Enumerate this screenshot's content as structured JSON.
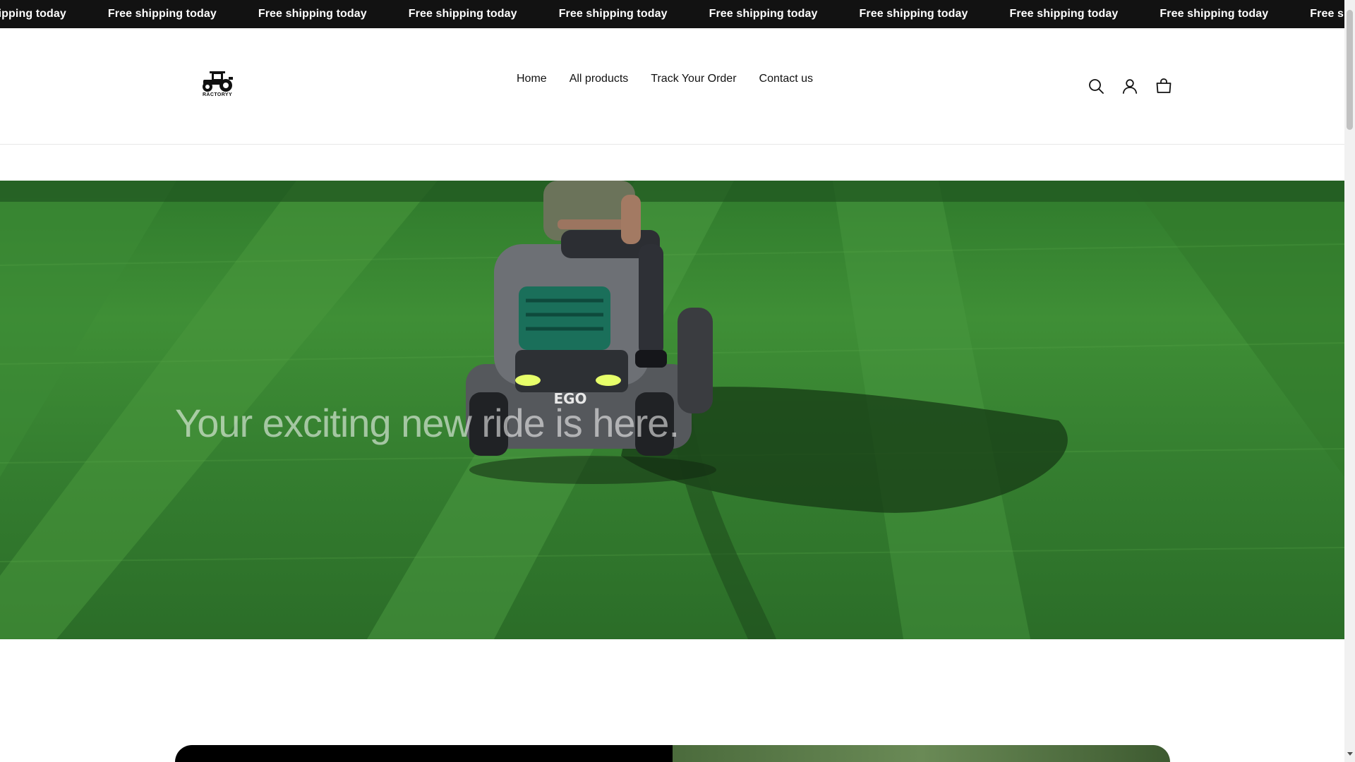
{
  "announcement": {
    "items": [
      "Free shipping today",
      "Free shipping today",
      "Free shipping today",
      "Free shipping today",
      "Free shipping today",
      "Free shipping today",
      "Free shipping today",
      "Free shipping today",
      "Free shipping today",
      "Free shipping today"
    ]
  },
  "header": {
    "logo_text": "RACTORYY",
    "nav": {
      "home": "Home",
      "all_products": "All products",
      "track_order": "Track Your Order",
      "contact": "Contact us"
    },
    "icons": [
      "search-icon",
      "account-icon",
      "cart-icon"
    ]
  },
  "hero": {
    "heading": "Your exciting new ride is here.",
    "mower_brand": "EGO"
  },
  "colors": {
    "announcement_bg": "#121212",
    "grass": "#3a8a33",
    "text": "#121212"
  }
}
